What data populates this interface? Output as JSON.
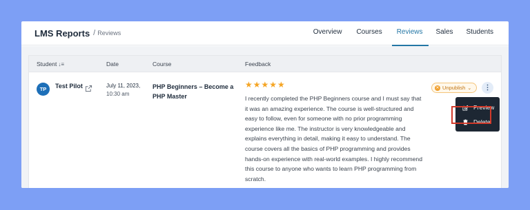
{
  "header": {
    "app_title": "LMS Reports",
    "separator": "/",
    "breadcrumb": "Reviews"
  },
  "nav": [
    {
      "label": "Overview"
    },
    {
      "label": "Courses"
    },
    {
      "label": "Reviews",
      "active": true
    },
    {
      "label": "Sales"
    },
    {
      "label": "Students"
    }
  ],
  "table": {
    "columns": {
      "student": "Student",
      "date": "Date",
      "course": "Course",
      "feedback": "Feedback"
    },
    "rows": [
      {
        "avatar": "TP",
        "student_name": "Test Pilot",
        "date": "July 11, 2023,",
        "time": "10:30 am",
        "course": "PHP Beginners – Become a PHP Master",
        "rating": 5,
        "stars": "★★★★★",
        "feedback": "I recently completed the PHP Beginners course and I must say that it was an amazing experience. The course is well-structured and easy to follow, even for someone with no prior programming experience like me. The instructor is very knowledgeable and explains everything in detail, making it easy to understand. The course covers all the basics of PHP programming and provides hands-on experience with real-world examples. I highly recommend this course to anyone who wants to learn PHP programming from scratch.",
        "status": "Unpublish"
      }
    ]
  },
  "actions_menu": {
    "preview": "Preview",
    "delete": "Delete"
  },
  "colors": {
    "background": "#7d9ff5",
    "accent": "#2376a5",
    "star": "#f5a524",
    "badge": "#c27512",
    "menu_bg": "#1d2733",
    "highlight": "#d23a2a"
  }
}
